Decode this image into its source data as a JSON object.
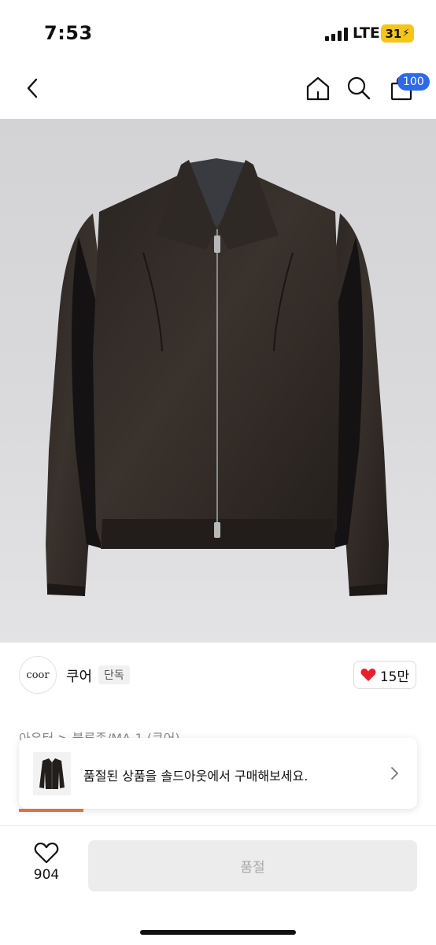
{
  "status_bar": {
    "time": "7:53",
    "network": "LTE",
    "battery": "31"
  },
  "nav": {
    "back_icon": "chevron-left-icon",
    "home_icon": "home-icon",
    "search_icon": "search-icon",
    "bag_icon": "shopping-bag-icon",
    "cart_count": "100"
  },
  "product": {
    "image_description_icon": "jacket-photo",
    "brand_logo_text": "coor",
    "brand_name": "쿠어",
    "exclusive_tag": "단독",
    "likes": "15만",
    "category_path": "아우터 > 블루종/MA-1 (쿠어)"
  },
  "soldout_banner": {
    "text": "품절된 상품을 솔드아웃에서 구매해보세요."
  },
  "bottom_bar": {
    "wish_count": "904",
    "buy_label": "품절"
  },
  "colors": {
    "badge_blue": "#2b6bea",
    "heart_red": "#e8202b",
    "accent_orange": "#e76a4a",
    "battery_yellow": "#f5c518"
  }
}
